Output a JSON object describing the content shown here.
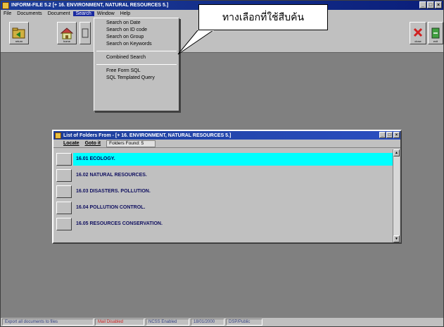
{
  "window": {
    "title": "INFORM-FILE 5.2 [+ 16. ENVIRONMENT, NATURAL RESOURCES 5.]",
    "buttons": [
      "_",
      "□",
      "×"
    ]
  },
  "menubar": {
    "items": [
      "File",
      "Documents",
      "Document",
      "Search",
      "Window",
      "Help"
    ]
  },
  "toolbar": {
    "buttons": [
      {
        "name": "return",
        "label": "return"
      },
      {
        "name": "home",
        "label": "home"
      },
      {
        "name": "close",
        "label": "close"
      },
      {
        "name": "exit",
        "label": "exit"
      }
    ]
  },
  "search_menu": {
    "group1": [
      "Search on Date",
      "Search on ID code",
      "Search on Group",
      "Search on Keywords"
    ],
    "group2": [
      "Combined Search"
    ],
    "group3": [
      "Free Form SQL",
      "SQL Templated Query"
    ]
  },
  "callout": {
    "text": "ทางเลือกที่ใช้สืบค้น"
  },
  "child_window": {
    "title": "List of Folders From - [+ 16. ENVIRONMENT, NATURAL RESOURCES 5.]",
    "toolbar": {
      "locate": "Locate",
      "goto": "Goto it",
      "folders_found": "Folders Found: 5"
    },
    "rows": [
      "16.01 ECOLOGY.",
      "16.02 NATURAL RESOURCES.",
      "16.03 DISASTERS. POLLUTION.",
      "16.04 POLLUTION CONTROL.",
      "16.05 RESOURCES CONSERVATION."
    ],
    "selected_index": 0
  },
  "statusbar": {
    "items": [
      "Export all documents to files",
      "Mail Disabled",
      "NCSS Enabled",
      "18/01/2000",
      "DSP/Public"
    ]
  },
  "colors": {
    "title_bar": "#1d3e9a",
    "selection": "#00ffff",
    "desktop": "#808080"
  }
}
